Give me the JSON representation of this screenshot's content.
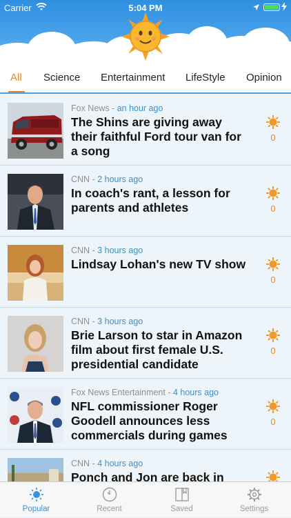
{
  "status_bar": {
    "carrier": "Carrier",
    "time": "5:04 PM"
  },
  "categories": {
    "items": [
      "All",
      "Science",
      "Entertainment",
      "LifeStyle",
      "Opinion"
    ],
    "active": "All"
  },
  "articles": [
    {
      "source": "Fox News",
      "separator": " - ",
      "time": "an hour ago",
      "headline": "The Shins are giving away their faithful Ford tour van for a song",
      "score": "0"
    },
    {
      "source": "CNN",
      "separator": " - ",
      "time": "2 hours ago",
      "headline": "In coach's rant, a lesson for parents and athletes",
      "score": "0"
    },
    {
      "source": "CNN",
      "separator": " - ",
      "time": "3 hours ago",
      "headline": "Lindsay Lohan's new TV show",
      "score": "0"
    },
    {
      "source": "CNN",
      "separator": " - ",
      "time": "3 hours ago",
      "headline": "Brie Larson to star in Amazon film about first female U.S. presidential candidate",
      "score": "0"
    },
    {
      "source": "Fox News Entertainment",
      "separator": " - ",
      "time": "4 hours ago",
      "headline": "NFL commissioner Roger Goodell announces less commercials during games",
      "score": "0"
    },
    {
      "source": "CNN",
      "separator": " - ",
      "time": "4 hours ago",
      "headline": "Ponch and Jon are back in",
      "score": ""
    }
  ],
  "tab_bar": {
    "popular": "Popular",
    "recent": "Recent",
    "saved": "Saved",
    "settings": "Settings",
    "active": "Popular"
  },
  "colors": {
    "accent": "#e8882a",
    "header_blue": "#2f8fe0",
    "link_blue": "#3f8fc7",
    "tab_active": "#3b8fdc"
  }
}
